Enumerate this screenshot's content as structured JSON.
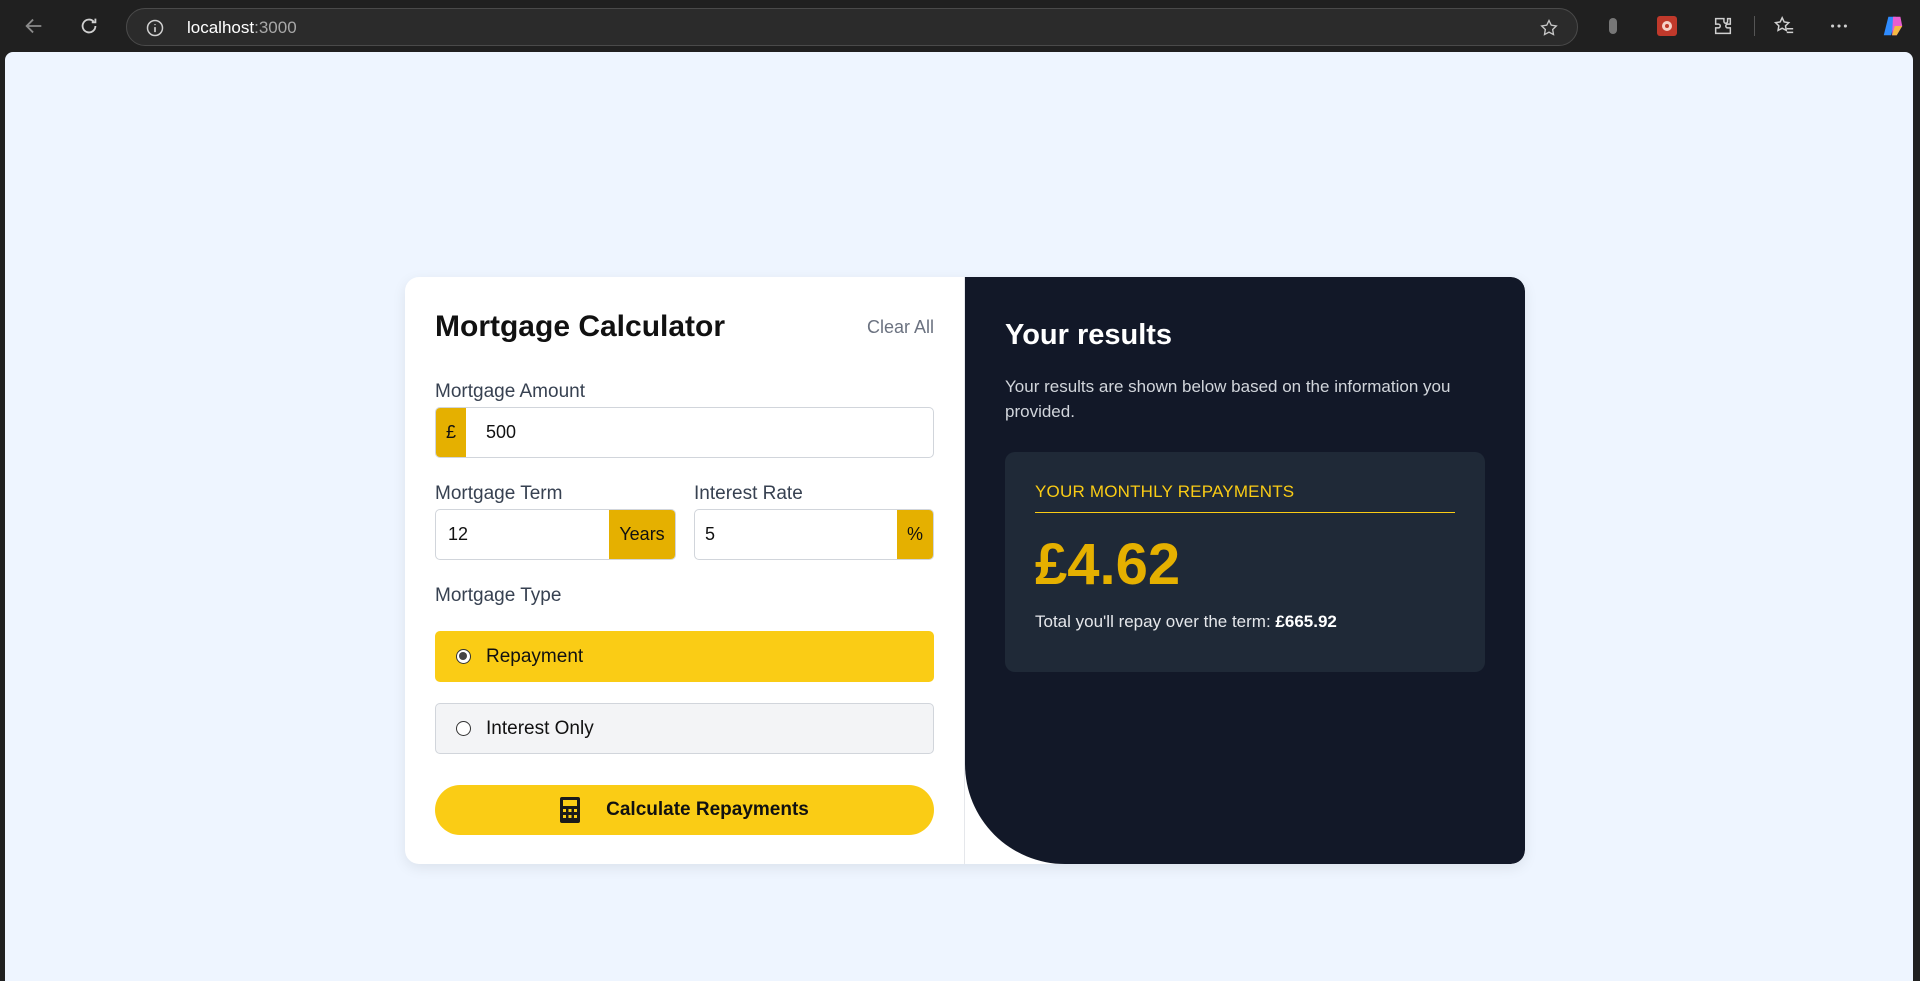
{
  "browser": {
    "url_host": "localhost",
    "url_port": ":3000"
  },
  "calculator": {
    "title": "Mortgage Calculator",
    "clear_all": "Clear All",
    "amount": {
      "label": "Mortgage Amount",
      "prefix": "£",
      "value": "500"
    },
    "term": {
      "label": "Mortgage Term",
      "value": "12",
      "suffix": "Years"
    },
    "rate": {
      "label": "Interest Rate",
      "value": "5",
      "suffix": "%"
    },
    "type": {
      "label": "Mortgage Type",
      "options": [
        {
          "label": "Repayment",
          "selected": true
        },
        {
          "label": "Interest Only",
          "selected": false
        }
      ]
    },
    "calculate_button": "Calculate Repayments"
  },
  "results": {
    "title": "Your results",
    "description": "Your results are shown below based on the information you provided.",
    "monthly_label": "YOUR MONTHLY REPAYMENTS",
    "monthly_value": "£4.62",
    "total_label": "Total you'll repay over the term:",
    "total_value": "£665.92"
  },
  "colors": {
    "accent": "#facc15",
    "accent_dark": "#e5b000",
    "results_bg": "#121828",
    "page_bg": "#eef5ff"
  },
  "icons": [
    "back-arrow-icon",
    "refresh-icon",
    "info-icon",
    "star-icon",
    "extension-icon",
    "favorites-icon",
    "more-icon",
    "copilot-icon",
    "calculator-icon"
  ]
}
